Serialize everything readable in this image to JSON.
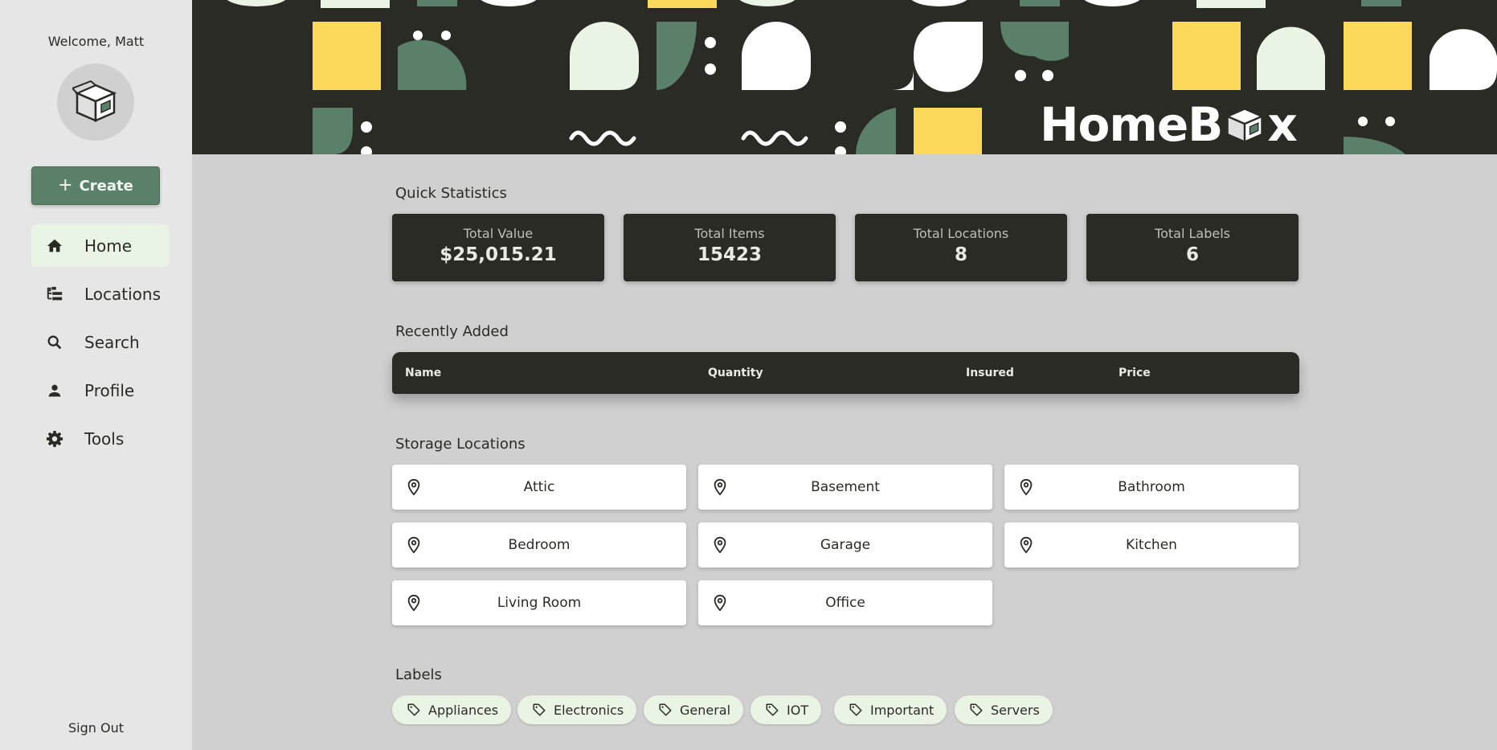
{
  "sidebar": {
    "welcome": "Welcome, Matt",
    "create_label": "Create",
    "nav": [
      {
        "label": "Home",
        "icon": "home-icon",
        "active": true
      },
      {
        "label": "Locations",
        "icon": "tree-icon",
        "active": false
      },
      {
        "label": "Search",
        "icon": "search-icon",
        "active": false
      },
      {
        "label": "Profile",
        "icon": "person-icon",
        "active": false
      },
      {
        "label": "Tools",
        "icon": "gear-icon",
        "active": false
      }
    ],
    "sign_out": "Sign Out"
  },
  "banner": {
    "logo_text": "HomeB x"
  },
  "quick_stats": {
    "title": "Quick Statistics",
    "cards": [
      {
        "label": "Total Value",
        "value": "$25,015.21"
      },
      {
        "label": "Total Items",
        "value": "15423"
      },
      {
        "label": "Total Locations",
        "value": "8"
      },
      {
        "label": "Total Labels",
        "value": "6"
      }
    ]
  },
  "recent": {
    "title": "Recently Added",
    "columns": [
      "Name",
      "Quantity",
      "Insured",
      "Price"
    ]
  },
  "storage": {
    "title": "Storage Locations",
    "locations": [
      "Attic",
      "Basement",
      "Bathroom",
      "Bedroom",
      "Garage",
      "Kitchen",
      "Living Room",
      "Office"
    ]
  },
  "labels": {
    "title": "Labels",
    "items": [
      "Appliances",
      "Electronics",
      "General",
      "IOT",
      "Important",
      "Servers"
    ]
  },
  "colors": {
    "dark": "#2b2b26",
    "green": "#5b806a",
    "yellow": "#fcd95b",
    "mint": "#eaf4e5",
    "white": "#ffffff"
  }
}
